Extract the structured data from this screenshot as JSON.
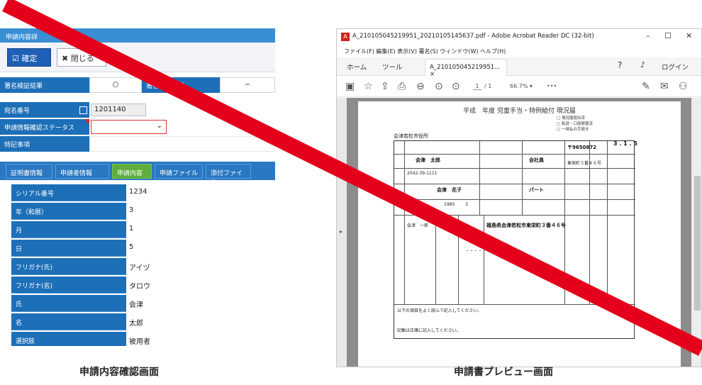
{
  "left": {
    "title": "申請内容詳",
    "confirm_label": "☑ 確定",
    "close_label": "✖ 閉じる",
    "sig_label": "署名検証結果",
    "sig_value": "○",
    "sig2_label": "署名検証結果",
    "sig2_value": "−",
    "addr_label": "宛名番号",
    "addr_value": "1201140",
    "status_label": "申請情報確認ステータス",
    "notes_label": "特記事項",
    "tabs": [
      "証明書情報",
      "申請者情報",
      "申請内容",
      "申請ファイル",
      "添付ファイル"
    ],
    "rows": [
      {
        "label": "シリアル番号",
        "value": "1234"
      },
      {
        "label": "年（和暦）",
        "value": "3"
      },
      {
        "label": "月",
        "value": "1"
      },
      {
        "label": "日",
        "value": "5"
      },
      {
        "label": "フリガナ(氏)",
        "value": "アイヅ"
      },
      {
        "label": "フリガナ(名)",
        "value": "タロウ"
      },
      {
        "label": "氏",
        "value": "会津"
      },
      {
        "label": "名",
        "value": "太郎"
      },
      {
        "label": "選択肢",
        "value": "被用者"
      }
    ],
    "caption": "申請内容確認画面"
  },
  "right": {
    "window_title": "A_210105045219951_20210105145637.pdf - Adobe Acrobat Reader DC (32-bit)",
    "menu": "ファイル(F)   編集(E)   表示(V)   署名(S)   ウィンドウ(W)   ヘルプ(H)",
    "tab_home": "ホーム",
    "tab_tools": "ツール",
    "doc_tab": "A_210105045219951...  ×",
    "login": "ログイン",
    "page_field": "1",
    "page_total": "/ 1",
    "zoom": "66.7%  ▾",
    "more": "•••",
    "form_title": "平成　年度 児童手当・特例給付 現況届",
    "form": {
      "city": "会津若松市役所",
      "postal": "〒9650872",
      "employer": "会社員",
      "date": "3 . 1 . 5",
      "name_a": "会津　太郎",
      "name_b": "会津　花子",
      "part": "パート",
      "address": "福島県会津若松市東栄町３番４６号",
      "addr_short": "東栄町３番４６号",
      "id": "2042-39-1111",
      "year": "1985",
      "month": "3",
      "note": "・・・・",
      "checks": [
        "□ 現況届提出済",
        "□ 転送・口座振替済",
        "□ 一時払の手続き"
      ],
      "ichiro": "会津　一郎",
      "foot1": "以下の項目をよく読んで記入してください。",
      "foot2": "記載は正確に記入してください。"
    },
    "caption": "申請書プレビュー画面"
  },
  "colors": {
    "header_blue": "#1d6fb8",
    "tab_active_green": "#5fae3d",
    "slash_red": "#e4001b"
  }
}
